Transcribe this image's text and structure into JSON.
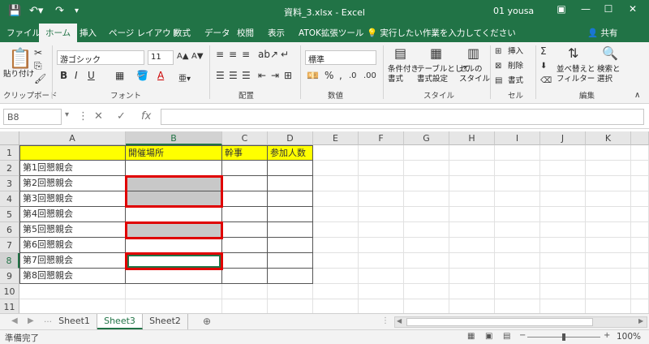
{
  "titlebar": {
    "save_icon": "save-icon",
    "undo_icon": "undo-icon",
    "redo_icon": "redo-icon",
    "title": "資料_3.xlsx  -  Excel",
    "user": "01 yousa",
    "minimize": "—",
    "maximize": "☐",
    "close": "✕",
    "ribbon_display_icon": "ribbon-display-icon"
  },
  "tabs": [
    "ファイル",
    "ホーム",
    "挿入",
    "ページ レイアウト",
    "数式",
    "データ",
    "校閲",
    "表示",
    "ATOK拡張ツール"
  ],
  "active_tab": "ホーム",
  "tell_me": "実行したい作業を入力してください",
  "share": "共有",
  "ribbon": {
    "clipboard": {
      "paste": "貼り付け",
      "label": "クリップボード"
    },
    "font": {
      "name": "游ゴシック",
      "size": "11",
      "label": "フォント",
      "bold": "B",
      "italic": "I",
      "underline": "U"
    },
    "alignment": {
      "label": "配置"
    },
    "number": {
      "format": "標準",
      "label": "数値",
      "percent": "%",
      "comma": ","
    },
    "styles": {
      "conditional": "条件付き\n書式",
      "table": "テーブルとして\n書式設定",
      "cell_styles": "セルの\nスタイル",
      "label": "スタイル"
    },
    "cells": {
      "insert": "挿入",
      "delete": "削除",
      "format": "書式",
      "label": "セル"
    },
    "editing": {
      "sort_filter": "並べ替えと\nフィルター",
      "find_select": "検索と\n選択",
      "label": "編集",
      "sum": "Σ"
    }
  },
  "formula_bar": {
    "name_box": "B8",
    "fx": "fx",
    "value": ""
  },
  "grid": {
    "columns": [
      "A",
      "B",
      "C",
      "D",
      "E",
      "F",
      "G",
      "H",
      "I",
      "J",
      "K"
    ],
    "selected_column": "B",
    "rows": [
      "1",
      "2",
      "3",
      "4",
      "5",
      "6",
      "7",
      "8",
      "9",
      "10",
      "11"
    ],
    "selected_row": "8",
    "cells": {
      "A1": "",
      "B1": "開催場所",
      "C1": "幹事",
      "D1": "参加人数",
      "A2": "第1回懇親会",
      "A3": "第2回懇親会",
      "A4": "第3回懇親会",
      "A5": "第4回懇親会",
      "A6": "第5回懇親会",
      "A7": "第6回懇親会",
      "A8": "第7回懇親会",
      "A9": "第8回懇親会"
    },
    "header_fill": "#ffff00",
    "gray_fill": "#c8c8c8",
    "highlight_border": "#e00000"
  },
  "sheets": [
    "Sheet1",
    "Sheet3",
    "Sheet2"
  ],
  "active_sheet": "Sheet3",
  "add_sheet": "⊕",
  "status": {
    "ready": "準備完了",
    "zoom": "100%",
    "zoom_minus": "−",
    "zoom_plus": "+"
  }
}
